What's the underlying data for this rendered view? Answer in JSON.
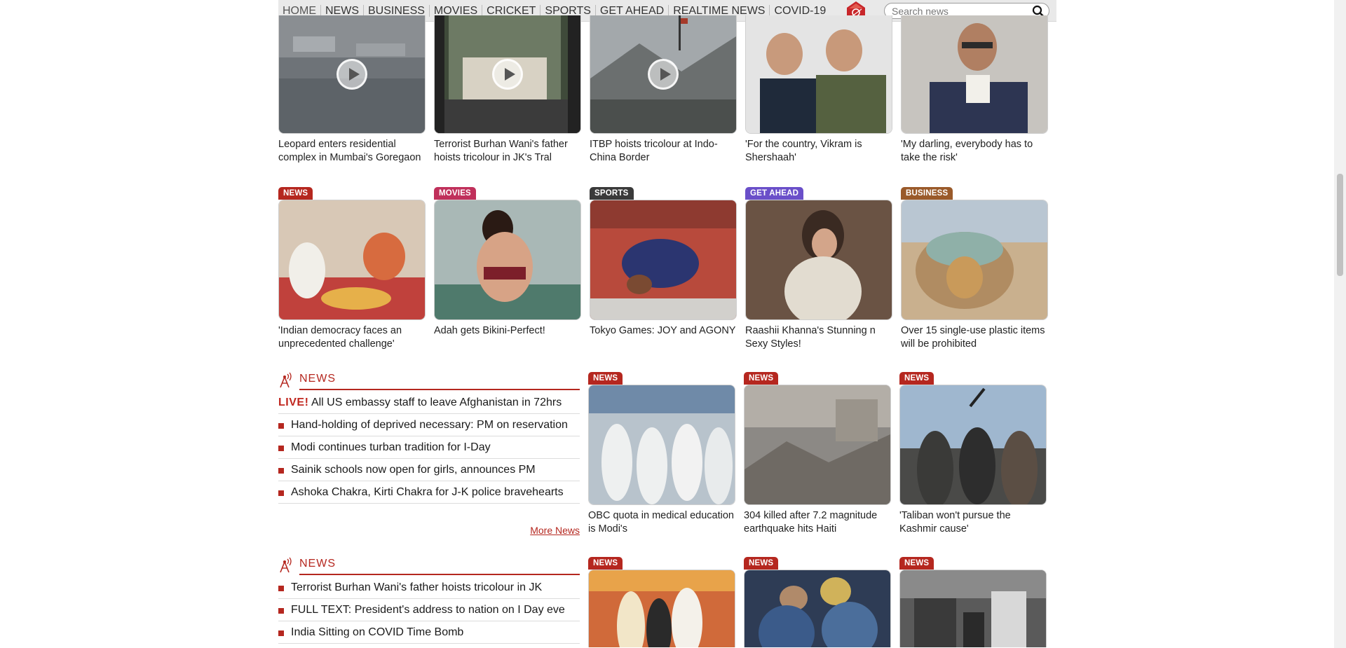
{
  "nav": {
    "items": [
      "HOME",
      "NEWS",
      "BUSINESS",
      "MOVIES",
      "CRICKET",
      "SPORTS",
      "GET AHEAD",
      "REALTIME NEWS",
      "COVID-19"
    ],
    "active": "HOME",
    "logo_icon": "rediff-logo-icon"
  },
  "search": {
    "placeholder": "Search news",
    "icon": "search-icon"
  },
  "videos": [
    {
      "caption": "Leopard enters residential complex in Mumbai's Goregaon"
    },
    {
      "caption": "Terrorist Burhan Wani's father hoists tricolour in JK's Tral"
    },
    {
      "caption": "ITBP hoists tricolour at Indo-China Border"
    },
    {
      "caption": "'For the country, Vikram is Shershaah'"
    },
    {
      "caption": "'My darling, everybody has to take the risk'"
    }
  ],
  "features": [
    {
      "tag": "NEWS",
      "tag_color": "#b5271f",
      "caption": "'Indian democracy faces an unprecedented challenge'"
    },
    {
      "tag": "MOVIES",
      "tag_color": "#c0305b",
      "caption": "Adah gets Bikini-Perfect!"
    },
    {
      "tag": "SPORTS",
      "tag_color": "#3a3a3a",
      "caption": "Tokyo Games: JOY and AGONY"
    },
    {
      "tag": "GET AHEAD",
      "tag_color": "#6a4fc9",
      "caption": "Raashii Khanna's Stunning n Sexy Styles!"
    },
    {
      "tag": "BUSINESS",
      "tag_color": "#9a5a2a",
      "caption": "Over 15 single-use plastic items will be prohibited"
    }
  ],
  "panel1": {
    "title": "NEWS",
    "live_label": "LIVE!",
    "live_text": "All US embassy staff to leave Afghanistan in 72hrs",
    "items": [
      "Hand-holding of deprived necessary: PM on reservation",
      "Modi continues turban tradition for I-Day",
      "Sainik schools now open for girls, announces PM",
      "Ashoka Chakra, Kirti Chakra for J-K police bravehearts"
    ],
    "more": "More News"
  },
  "row3": [
    {
      "tag": "NEWS",
      "caption": "OBC quota in medical education is Modi's"
    },
    {
      "tag": "NEWS",
      "caption": "304 killed after 7.2 magnitude earthquake hits Haiti"
    },
    {
      "tag": "NEWS",
      "caption": "'Taliban won't pursue the Kashmir cause'"
    }
  ],
  "panel2": {
    "title": "NEWS",
    "items": [
      "Terrorist Burhan Wani's father hoists tricolour in JK",
      "FULL TEXT: President's address to nation on I Day eve",
      "India Sitting on COVID Time Bomb"
    ]
  },
  "row4": [
    {
      "tag": "NEWS"
    },
    {
      "tag": "NEWS"
    },
    {
      "tag": "NEWS"
    }
  ],
  "colors": {
    "accent": "#b5271f",
    "nav_bg": "#e9e9e9"
  }
}
